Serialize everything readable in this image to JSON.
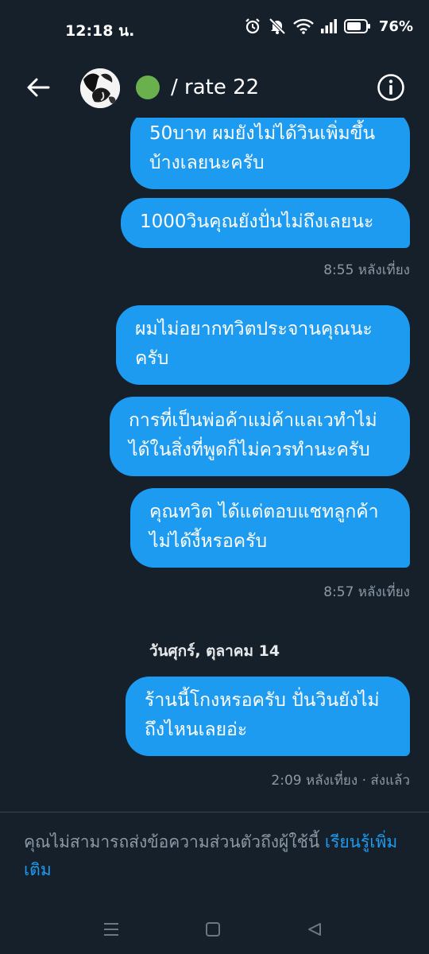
{
  "status_bar": {
    "time": "12:18 น.",
    "battery": "76%",
    "icons": [
      "alarm-icon",
      "muted-bell-icon",
      "wifi-icon",
      "signal-icon",
      "battery-icon"
    ]
  },
  "header": {
    "title": "/ rate 22",
    "status_color": "#6ab04c"
  },
  "messages": [
    {
      "text": "50บาท ผมยังไม่ได้วินเพิ่มขึ้น\nบ้างเลยนะครับ"
    },
    {
      "text": "1000วินคุณยังปั่นไม่ถึงเลยนะ"
    },
    {
      "meta": "8:55 หลังเที่ยง"
    },
    {
      "text": "ผมไม่อยากทวิตประจานคุณนะ\nครับ"
    },
    {
      "text": "การที่เป็นพ่อค้าแม่ค้าแลเวทำไม่\nได้ในสิ่งที่พูดก็ไม่ควรทำนะครับ"
    },
    {
      "text": "คุณทวิต ได้แต่ตอบแชทลูกค้า\nไม่ได้งี้หรอครับ"
    },
    {
      "meta": "8:57 หลังเที่ยง"
    },
    {
      "date": "วันศุกร์, ตุลาคม 14"
    },
    {
      "text": "ร้านนี้โกงหรอครับ ปั่นวินยังไม่\nถึงไหนเลยอ่ะ"
    },
    {
      "meta": "2:09 หลังเที่ยง · ส่งแล้ว"
    }
  ],
  "footer": {
    "notice": "คุณไม่สามารถส่งข้อความส่วนตัวถึงผู้ใช้นี้ ",
    "link": "เรียนรู้เพิ่มเติม"
  },
  "colors": {
    "background": "#15202b",
    "bubble": "#1d9bf0",
    "muted_text": "#8b98a5"
  }
}
